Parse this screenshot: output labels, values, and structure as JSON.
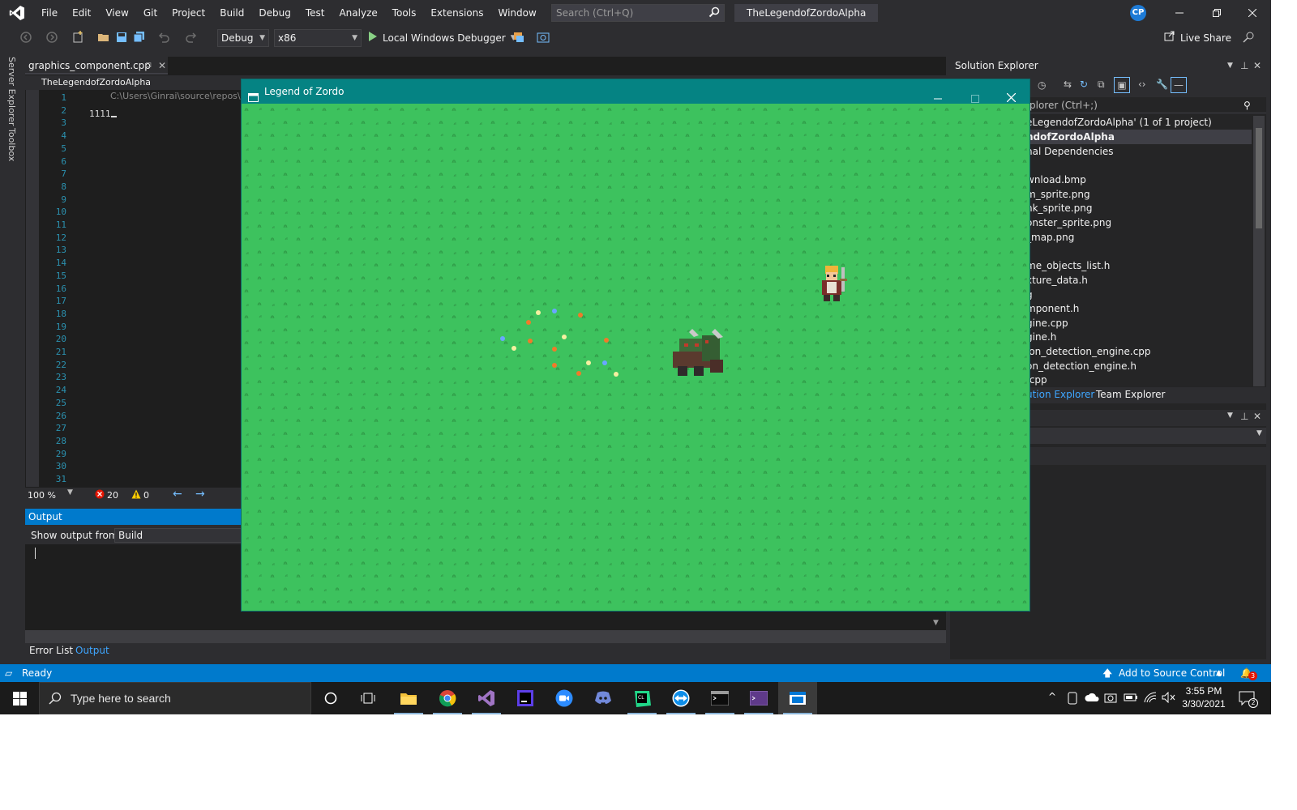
{
  "menu": {
    "items": [
      "File",
      "Edit",
      "View",
      "Git",
      "Project",
      "Build",
      "Debug",
      "Test",
      "Analyze",
      "Tools",
      "Extensions",
      "Window",
      "Help"
    ],
    "search_placeholder": "Search (Ctrl+Q)",
    "solution_name": "TheLegendofZordoAlpha",
    "user_initials": "CP"
  },
  "toolbar": {
    "config": "Debug",
    "platform": "x86",
    "run_label": "Local Windows Debugger",
    "live_share": "Live Share"
  },
  "side_tabs": [
    "Server Explorer",
    "Toolbox"
  ],
  "editor": {
    "tab_title": "graphics_component.cpp",
    "nav_project": "TheLegendofZordoAlpha",
    "path": "C:\\Users\\Ginrai\\source\\repos\\",
    "line_numbers": [
      "1",
      "2",
      "3",
      "4",
      "5",
      "6",
      "7",
      "8",
      "9",
      "10",
      "11",
      "12",
      "13",
      "14",
      "15",
      "16",
      "17",
      "18",
      "19",
      "20",
      "21",
      "22",
      "23",
      "24",
      "25",
      "26",
      "27",
      "28",
      "29",
      "30",
      "31"
    ],
    "code_text": "1111",
    "zoom": "100 %",
    "errors": "20",
    "warnings": "0"
  },
  "output": {
    "title": "Output",
    "show_from_label": "Show output from:",
    "source": "Build"
  },
  "bottom_tabs": [
    "Error List",
    "Output"
  ],
  "solution_explorer": {
    "title": "Solution Explorer",
    "search": "plorer (Ctrl+;)",
    "items": [
      "eLegendofZordoAlpha' (1 of 1 project)",
      "ndofZordoAlpha",
      "nal Dependencies",
      "wnload.bmp",
      "m_sprite.png",
      "nk_sprite.png",
      "onster_sprite.png",
      "_map.png",
      "me_objects_list.h",
      "xture_data.h",
      "g",
      "mponent.h",
      "gine.cpp",
      "gine.h",
      "ion_detection_engine.cpp",
      "on_detection_engine.h",
      ".cpp"
    ],
    "tabs": [
      "ution Explorer",
      "Team Explorer"
    ]
  },
  "statusbar": {
    "state": "Ready",
    "source_control": "Add to Source Control",
    "notifications": "3"
  },
  "game_window": {
    "title": "Legend of Zordo",
    "grass_color": "#3dc25e",
    "titlebar_color": "#058383"
  },
  "taskbar": {
    "search_placeholder": "Type here to search",
    "time": "3:55 PM",
    "date": "3/30/2021",
    "notification_count": "2"
  },
  "colors": {
    "accent": "#007acc",
    "ide_bg": "#2d2d30",
    "editor_bg": "#1e1e1e"
  }
}
